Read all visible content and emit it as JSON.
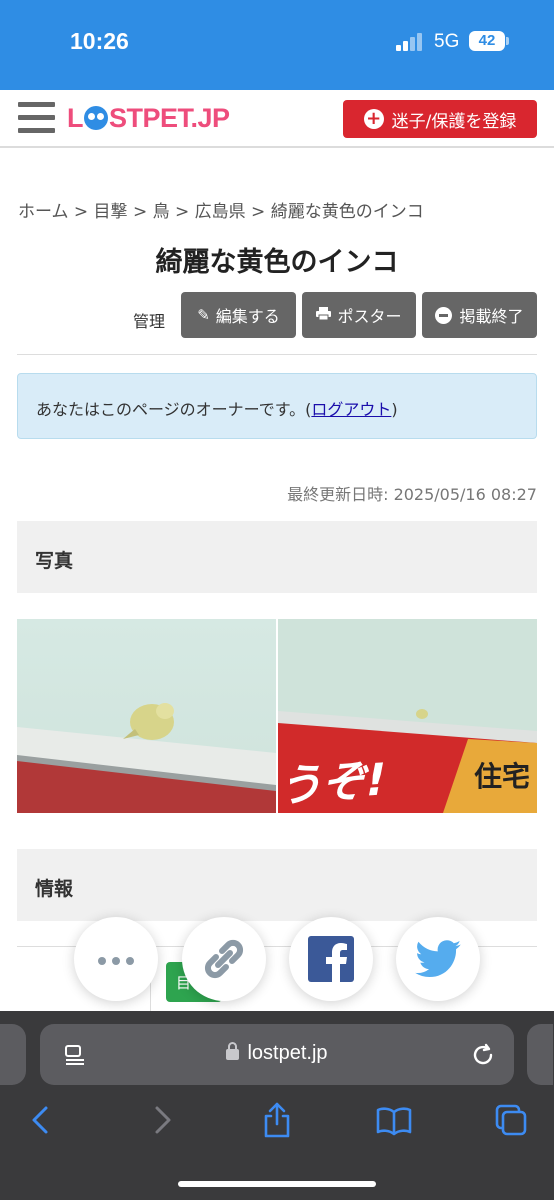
{
  "status_bar": {
    "time": "10:26",
    "network": "5G",
    "battery": "42"
  },
  "header": {
    "logo": {
      "left": "L",
      "right": "STPET.JP"
    },
    "register_button": "迷子/保護を登録"
  },
  "breadcrumb": "ホーム > 目撃 > 鳥 > 広島県 > 綺麗な黄色のインコ",
  "page_title": "綺麗な黄色のインコ",
  "toolbar": {
    "admin_label": "管理",
    "edit": "編集する",
    "poster": "ポスター",
    "end": "掲載終了"
  },
  "owner_notice": {
    "text": "あなたはこのページのオーナーです。(",
    "logout": "ログアウト",
    "close": ")"
  },
  "updated": "最終更新日時:  2025/05/16 08:27",
  "sections": {
    "photos": "写真",
    "info": "情報"
  },
  "photo_sign": {
    "big": "うぞ!",
    "small": "住宅"
  },
  "info_tag": "目",
  "share": {
    "more": "more-icon",
    "link": "link-icon",
    "facebook": "facebook-icon",
    "twitter": "twitter-icon"
  },
  "browser": {
    "url": "lostpet.jp"
  },
  "colors": {
    "status_bar": "#2f8de4",
    "register": "#d9262f",
    "logo": "#ee4d7c",
    "tool_button": "#666666",
    "notice_bg": "#d9ecf8"
  }
}
